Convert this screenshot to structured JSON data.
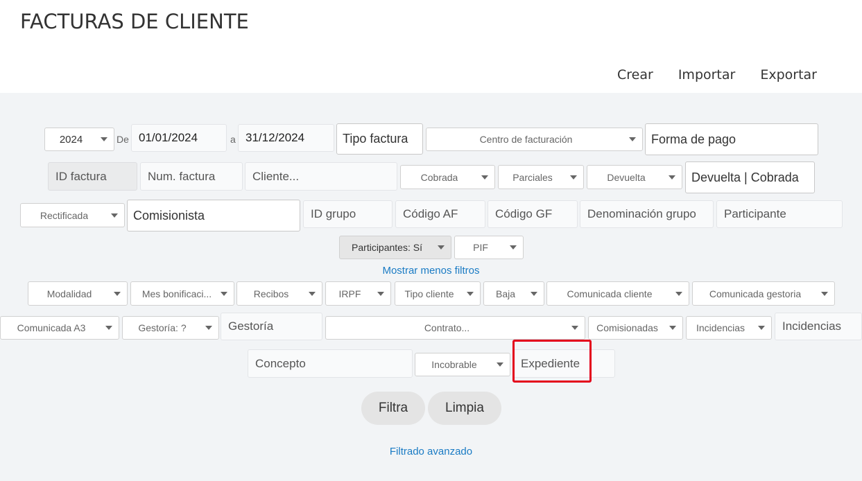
{
  "header": {
    "title": "FACTURAS DE CLIENTE",
    "actions": [
      "Crear",
      "Importar",
      "Exportar"
    ]
  },
  "filters": {
    "year": "2024",
    "de_label": "De",
    "date_from": "01/01/2024",
    "a_label": "a",
    "date_to": "31/12/2024",
    "tipo_factura": "Tipo factura",
    "centro_facturacion": "Centro de facturación",
    "forma_pago": "Forma de pago",
    "id_factura": "ID factura",
    "num_factura": "Num. factura",
    "cliente": "Cliente...",
    "cobrada": "Cobrada",
    "parciales": "Parciales",
    "devuelta": "Devuelta",
    "devuelta_cobrada": "Devuelta | Cobrada",
    "rectificada": "Rectificada",
    "comisionista": "Comisionista",
    "id_grupo": "ID grupo",
    "codigo_af": "Código AF",
    "codigo_gf": "Código GF",
    "denominacion_grupo": "Denominación grupo",
    "participante": "Participante",
    "participantes": "Participantes: Sí",
    "pif": "PIF",
    "mostrar_menos": "Mostrar menos filtros",
    "modalidad": "Modalidad",
    "mes_bonificacion": "Mes bonificaci...",
    "recibos": "Recibos",
    "irpf": "IRPF",
    "tipo_cliente": "Tipo cliente",
    "baja": "Baja",
    "comunicada_cliente": "Comunicada cliente",
    "comunicada_gestoria": "Comunicada gestoria",
    "comunicada_a3": "Comunicada A3",
    "gestoria_sel": "Gestoría: ?",
    "gestoria": "Gestoría",
    "contrato": "Contrato...",
    "comisionadas": "Comisionadas",
    "incidencias_sel": "Incidencias",
    "incidencias": "Incidencias",
    "concepto": "Concepto",
    "incobrable": "Incobrable",
    "expediente": "Expediente"
  },
  "buttons": {
    "filtra": "Filtra",
    "limpia": "Limpia",
    "filtrado_avanzado": "Filtrado avanzado"
  },
  "colors": {
    "link": "#1a7bc4",
    "highlight": "#e3001b",
    "panel": "#f2f4f6"
  }
}
